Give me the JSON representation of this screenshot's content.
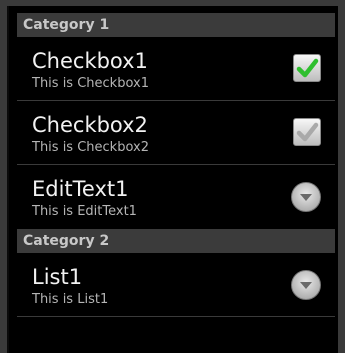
{
  "categories": [
    {
      "title": "Category 1",
      "items": [
        {
          "title": "Checkbox1",
          "summary": "This is Checkbox1",
          "widget": "checkbox",
          "checked": true
        },
        {
          "title": "Checkbox2",
          "summary": "This is Checkbox2",
          "widget": "checkbox",
          "checked": true
        },
        {
          "title": "EditText1",
          "summary": "This is EditText1",
          "widget": "spinner-arrow"
        }
      ]
    },
    {
      "title": "Category 2",
      "items": [
        {
          "title": "List1",
          "summary": "This is List1",
          "widget": "spinner-arrow"
        }
      ]
    }
  ],
  "colors": {
    "check_green": "#2fbf2f",
    "check_gray": "#a9a9a9"
  }
}
